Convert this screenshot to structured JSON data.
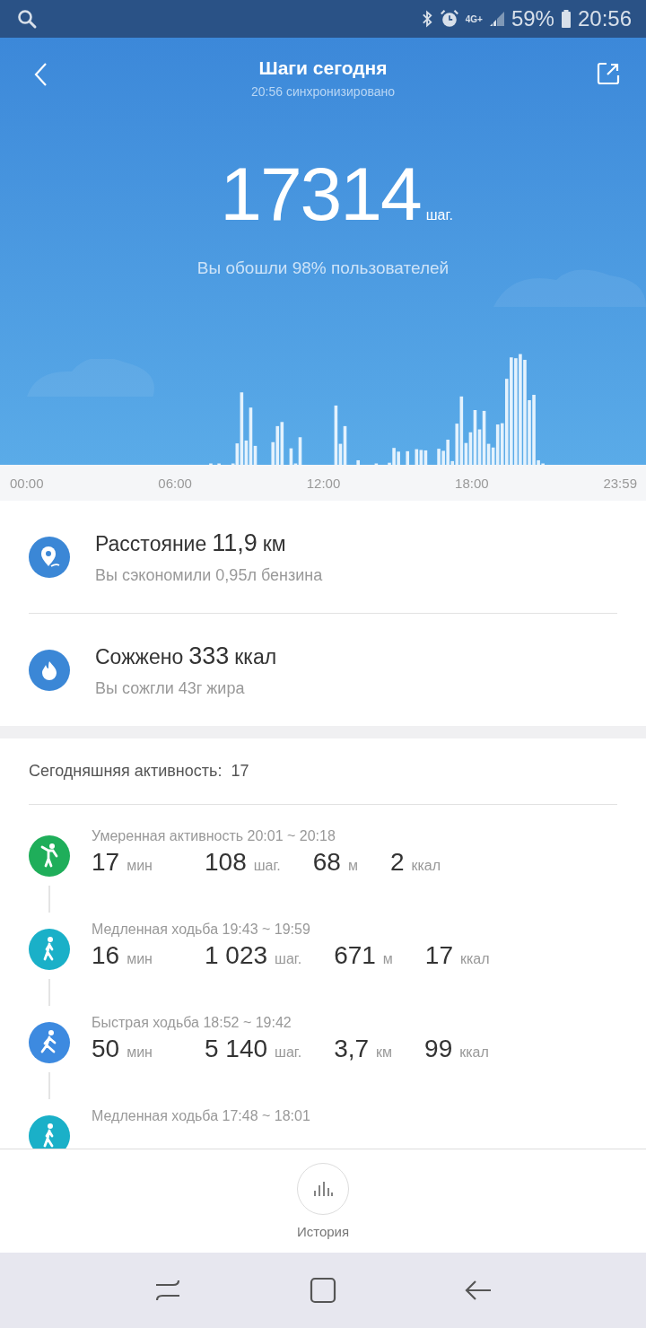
{
  "status_bar": {
    "network": "4G+",
    "battery": "59%",
    "time": "20:56"
  },
  "header": {
    "title": "Шаги сегодня",
    "subtitle": "20:56 синхронизировано"
  },
  "steps": {
    "value": "17314",
    "unit": "шаг.",
    "note": "Вы обошли 98% пользователей"
  },
  "chart_axis": [
    "00:00",
    "06:00",
    "12:00",
    "18:00",
    "23:59"
  ],
  "stats": [
    {
      "kind": "distance",
      "label": "Расстояние",
      "value": "11,9",
      "unit": "км",
      "note": "Вы сэкономили 0,95л бензина"
    },
    {
      "kind": "calories",
      "label": "Сожжено",
      "value": "333",
      "unit": "ккал",
      "note": "Вы сожгли 43г жира"
    }
  ],
  "activity": {
    "label": "Сегодняшняя активность:",
    "count": "17",
    "items": [
      {
        "kind": "moderate",
        "color": "#1fae5a",
        "title": "Умеренная активность 20:01 ~ 20:18",
        "metrics": [
          {
            "value": "17",
            "unit": "мин"
          },
          {
            "value": "108",
            "unit": "шаг."
          },
          {
            "value": "68",
            "unit": "м"
          },
          {
            "value": "2",
            "unit": "ккал"
          }
        ]
      },
      {
        "kind": "slow",
        "color": "#1ab0c8",
        "title": "Медленная ходьба 19:43 ~ 19:59",
        "metrics": [
          {
            "value": "16",
            "unit": "мин"
          },
          {
            "value": "1 023",
            "unit": "шаг."
          },
          {
            "value": "671",
            "unit": "м"
          },
          {
            "value": "17",
            "unit": "ккал"
          }
        ]
      },
      {
        "kind": "fast",
        "color": "#3d8ae0",
        "title": "Быстрая ходьба 18:52 ~ 19:42",
        "metrics": [
          {
            "value": "50",
            "unit": "мин"
          },
          {
            "value": "5 140",
            "unit": "шаг."
          },
          {
            "value": "3,7",
            "unit": "км"
          },
          {
            "value": "99",
            "unit": "ккал"
          }
        ]
      },
      {
        "kind": "slow",
        "color": "#1ab0c8",
        "title": "Медленная ходьба 17:48 ~ 18:01"
      }
    ]
  },
  "history_button": {
    "label": "История"
  }
}
